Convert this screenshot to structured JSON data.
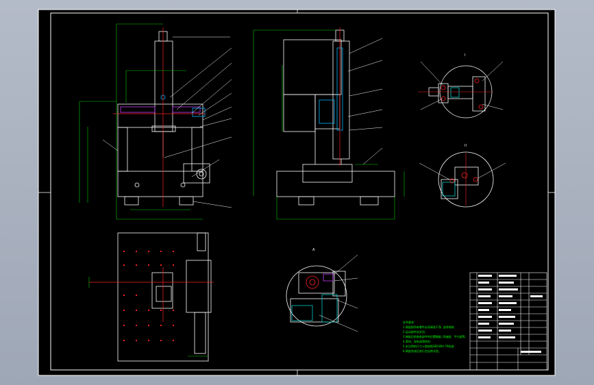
{
  "drawing": {
    "view_labels": {
      "view_i": "I",
      "view_ii": "II",
      "view_a": "A"
    },
    "notes": [
      "技术要求:",
      "1.装配前所有零件必须清洗干净, 去除毛刺;",
      "2.运动部件应灵活;",
      "3.装配后检查各部件的位置精度, 同轴度、平行度等;",
      "4.滑块、导轨润滑良好;",
      "5.未注明的尺寸公差按照GB1804-79标准;",
      "6.装配完成后进行空运转试验。"
    ],
    "title_block": {
      "title": "立式...",
      "rows": 12
    },
    "colors": {
      "background": "#000000",
      "frame": "#ffffff",
      "dimension": "#00cc00",
      "centerline": "#ff2020",
      "section": "#00b7ff",
      "hatch": "#00cccc"
    }
  }
}
